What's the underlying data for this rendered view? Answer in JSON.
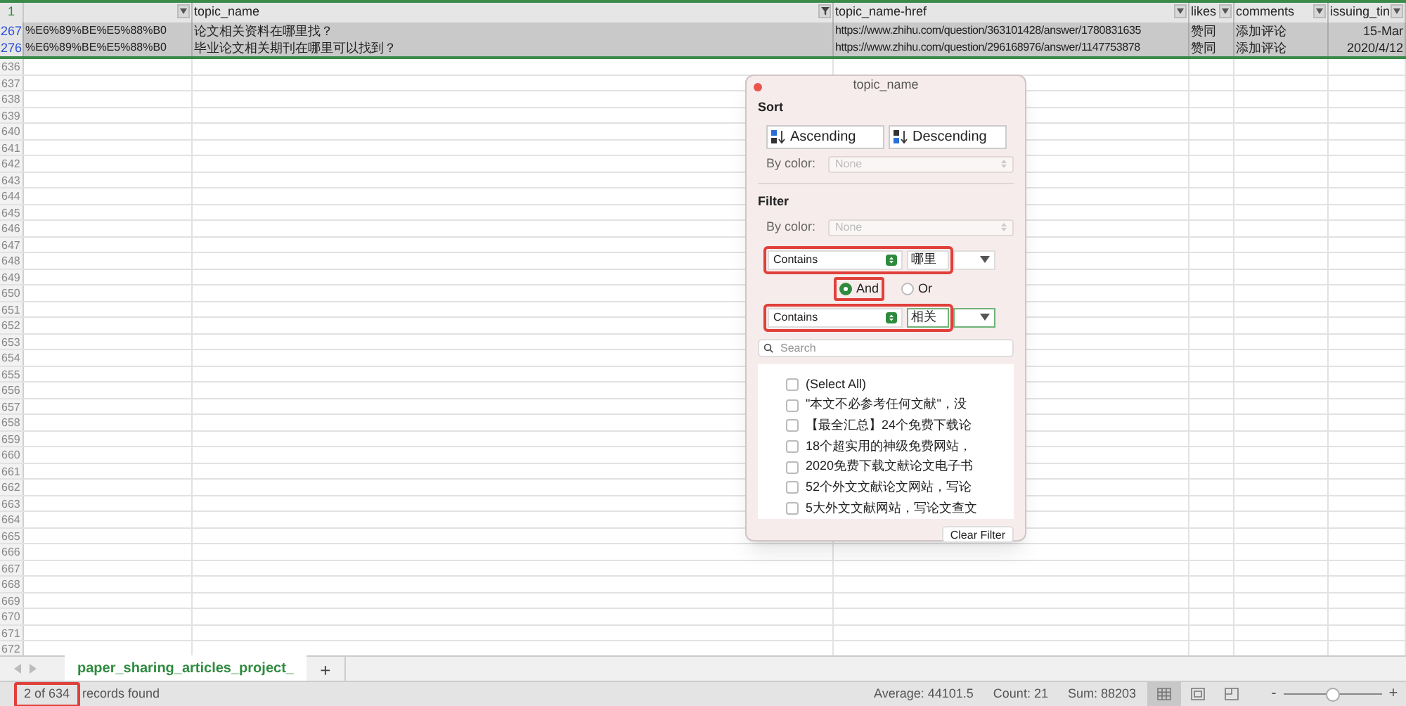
{
  "columns": [
    {
      "filtered": false
    },
    {
      "label": "topic_name",
      "filtered": true
    },
    {
      "label": "topic_name-href",
      "filtered": false
    },
    {
      "label": "likes",
      "filtered": false
    },
    {
      "label": "comments",
      "filtered": false
    },
    {
      "label": "issuing_tin",
      "filtered": false
    }
  ],
  "header_row": "1",
  "rows": [
    {
      "number": "267",
      "selected": true,
      "cells": [
        "%E6%89%BE%E5%88%B0",
        "论文相关资料在哪里找？",
        "https://www.zhihu.com/question/363101428/answer/1780831635",
        "赞同",
        "添加评论",
        "15-Mar"
      ]
    },
    {
      "number": "276",
      "selected": true,
      "cells": [
        "%E6%89%BE%E5%88%B0",
        "毕业论文相关期刊在哪里可以找到？",
        "https://www.zhihu.com/question/296168976/answer/1147753878",
        "赞同",
        "添加评论",
        "2020/4/12"
      ]
    }
  ],
  "empty_rows": [
    "636",
    "637",
    "638",
    "639",
    "640",
    "641",
    "642",
    "643",
    "644",
    "645",
    "646",
    "647",
    "648",
    "649",
    "650",
    "651",
    "652",
    "653",
    "654",
    "655",
    "656",
    "657",
    "658",
    "659",
    "660",
    "661",
    "662",
    "663",
    "664",
    "665",
    "666",
    "667",
    "668",
    "669",
    "670",
    "671",
    "672"
  ],
  "popup": {
    "title": "topic_name",
    "sort_heading": "Sort",
    "ascending": "Ascending",
    "descending": "Descending",
    "sort_by_color_label": "By color:",
    "sort_by_color_value": "None",
    "filter_heading": "Filter",
    "filter_by_color_label": "By color:",
    "filter_by_color_value": "None",
    "conditions": [
      {
        "operator": "Contains",
        "value": "哪里",
        "focused": false
      },
      {
        "operator": "Contains",
        "value": "相关",
        "focused": true
      }
    ],
    "joins": [
      {
        "label": "And",
        "selected": true
      },
      {
        "label": "Or",
        "selected": false
      }
    ],
    "search": {
      "placeholder": "Search"
    },
    "values": [
      {
        "label": "(Select All)",
        "checked": false
      },
      {
        "label": "\"本文不必参考任何文献\"，没",
        "checked": false
      },
      {
        "label": "【最全汇总】24个免费下载论",
        "checked": false
      },
      {
        "label": "18个超实用的神级免费网站，",
        "checked": false
      },
      {
        "label": "2020免费下载文献论文电子书",
        "checked": false
      },
      {
        "label": "52个外文文献论文网站，写论",
        "checked": false
      },
      {
        "label": "5大外文文献网站，写论文查文",
        "checked": false
      }
    ],
    "clear_button": "Clear Filter"
  },
  "sheet_tabs": [
    {
      "label": "paper_sharing_articles_project_",
      "selected": true
    }
  ],
  "add_sheet": "+",
  "status_bar": {
    "records_count": "2 of 634",
    "records_label": "records found",
    "average": "Average: 44101.5",
    "count": "Count: 21",
    "sum": "Sum: 88203",
    "views": [
      {
        "kind": "normal",
        "selected": true
      },
      {
        "kind": "page-layout",
        "selected": false
      },
      {
        "kind": "page-break",
        "selected": false
      }
    ],
    "zoom": {
      "minus": "-",
      "plus": "+",
      "level": 0.5
    }
  }
}
